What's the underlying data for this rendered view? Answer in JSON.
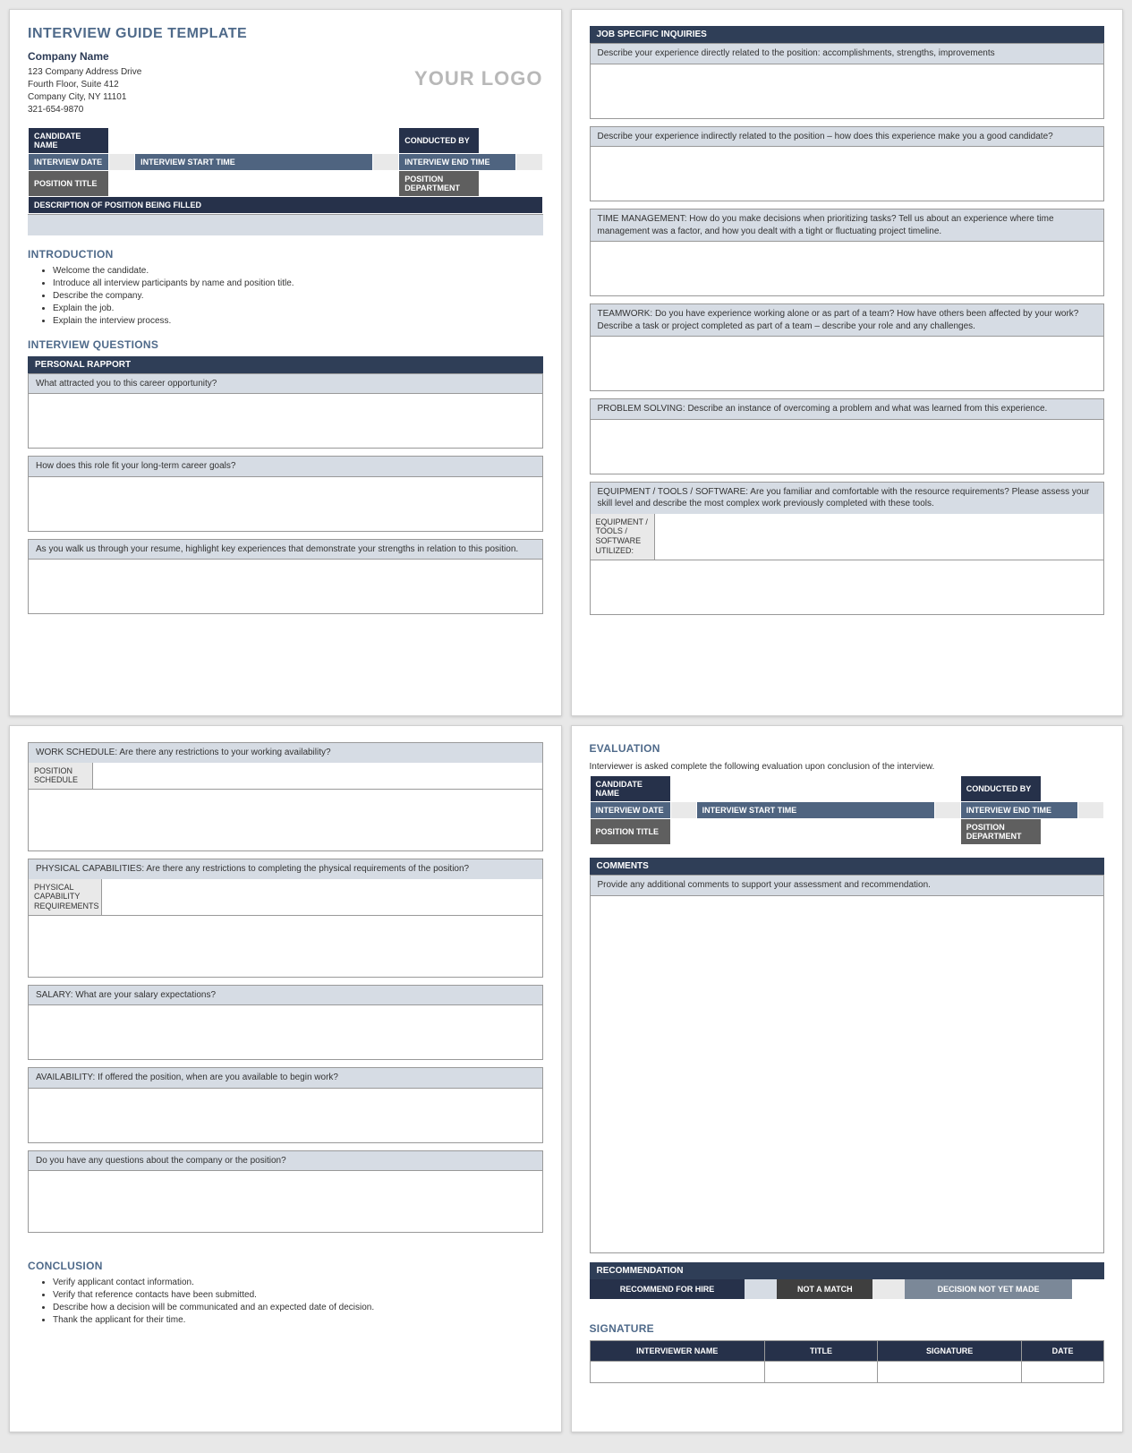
{
  "doc": {
    "title": "INTERVIEW GUIDE TEMPLATE",
    "company_label": "Company Name",
    "addr1": "123 Company Address Drive",
    "addr2": "Fourth Floor, Suite 412",
    "addr3": "Company City, NY  11101",
    "phone": "321-654-9870",
    "logo_placeholder": "YOUR LOGO"
  },
  "labels": {
    "candidate_name": "CANDIDATE NAME",
    "conducted_by": "CONDUCTED BY",
    "interview_date": "INTERVIEW DATE",
    "interview_start": "INTERVIEW START TIME",
    "interview_end": "INTERVIEW END TIME",
    "position_title": "POSITION TITLE",
    "position_dept": "POSITION DEPARTMENT",
    "description": "DESCRIPTION OF POSITION BEING FILLED"
  },
  "intro": {
    "heading": "INTRODUCTION",
    "items": [
      "Welcome the candidate.",
      "Introduce all interview participants by name and position title.",
      "Describe the company.",
      "Explain the job.",
      "Explain the interview process."
    ]
  },
  "iq": {
    "heading": "INTERVIEW QUESTIONS",
    "personal_rapport_bar": "PERSONAL RAPPORT",
    "q1": "What attracted you to this career opportunity?",
    "q2": "How does this role fit your long-term career goals?",
    "q3": "As you walk us through your resume, highlight key experiences that demonstrate your strengths in relation to this position."
  },
  "jsi": {
    "bar": "JOB SPECIFIC INQUIRIES",
    "q1": "Describe your experience directly related to the position: accomplishments, strengths, improvements",
    "q2": "Describe your experience indirectly related to the position – how does this experience make you a good candidate?",
    "q3": "TIME MANAGEMENT: How do you make decisions when prioritizing tasks? Tell us about an experience where time management was a factor, and how you dealt with a tight or fluctuating project timeline.",
    "q4": "TEAMWORK: Do you have experience working alone or as part of a team? How have others been affected by your work? Describe a task or project completed as part of a team – describe your role and any challenges.",
    "q5": "PROBLEM SOLVING: Describe an instance of overcoming a problem and what was learned from this experience.",
    "q6": "EQUIPMENT / TOOLS / SOFTWARE: Are you familiar and comfortable with the resource requirements? Please assess your skill level and describe the most complex work previously completed with these tools.",
    "q6_label": "EQUIPMENT / TOOLS / SOFTWARE UTILIZED:"
  },
  "p3": {
    "q1": "WORK SCHEDULE: Are there any restrictions to your working availability?",
    "q1_label": "POSITION SCHEDULE",
    "q2": "PHYSICAL CAPABILITIES: Are there any restrictions to completing the physical requirements of the position?",
    "q2_label": "PHYSICAL CAPABILITY REQUIREMENTS",
    "q3": "SALARY: What are your salary expectations?",
    "q4": "AVAILABILITY:  If offered the position, when are you available to begin work?",
    "q5": "Do you have any questions about the company or the position?"
  },
  "conclusion": {
    "heading": "CONCLUSION",
    "items": [
      "Verify applicant contact information.",
      "Verify that reference contacts have been submitted.",
      "Describe how a decision will be communicated and an expected date of decision.",
      "Thank the applicant for their time."
    ]
  },
  "eval": {
    "heading": "EVALUATION",
    "note": "Interviewer is asked complete the following evaluation upon conclusion of the interview.",
    "comments_bar": "COMMENTS",
    "comments_prompt": "Provide any additional comments to support your assessment and recommendation.",
    "recommendation_bar": "RECOMMENDATION",
    "rec1": "RECOMMEND FOR HIRE",
    "rec2": "NOT A MATCH",
    "rec3": "DECISION NOT YET MADE",
    "signature_heading": "SIGNATURE",
    "sig_cols": {
      "name": "INTERVIEWER NAME",
      "title": "TITLE",
      "sig": "SIGNATURE",
      "date": "DATE"
    }
  }
}
